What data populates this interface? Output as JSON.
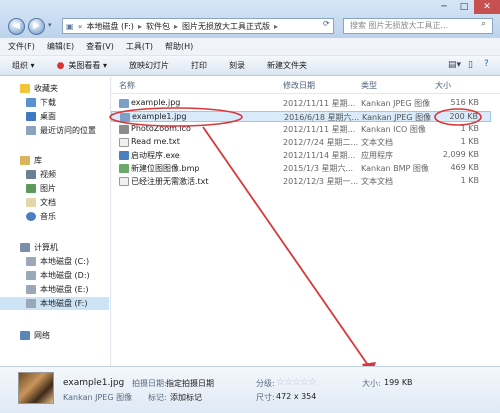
{
  "window": {
    "breadcrumb": [
      "本地磁盘 (F:)",
      "软件包",
      "图片无损放大工具正式版"
    ],
    "search_placeholder": "搜索 图片无损放大工具正...",
    "controls": [
      "─",
      "□",
      "✕"
    ]
  },
  "menu": [
    "文件(F)",
    "编辑(E)",
    "查看(V)",
    "工具(T)",
    "帮助(H)"
  ],
  "toolbar": [
    "组织 ▾",
    "美图看看 ▾",
    "放映幻灯片",
    "打印",
    "刻录",
    "新建文件夹"
  ],
  "nav": {
    "favorites": {
      "label": "收藏夹",
      "items": [
        "下载",
        "桌面",
        "最近访问的位置"
      ]
    },
    "libraries": {
      "label": "库",
      "items": [
        "视频",
        "图片",
        "文档",
        "音乐"
      ]
    },
    "computer": {
      "label": "计算机",
      "items": [
        "本地磁盘 (C:)",
        "本地磁盘 (D:)",
        "本地磁盘 (E:)",
        "本地磁盘 (F:)"
      ]
    },
    "network": "网络"
  },
  "columns": {
    "name": "名称",
    "date": "修改日期",
    "type": "类型",
    "size": "大小"
  },
  "files": [
    {
      "name": "example.jpg",
      "date": "2012/11/11 星期...",
      "type": "Kankan JPEG 图像",
      "size": "516 KB",
      "color": "#7aa0c8"
    },
    {
      "name": "example1.jpg",
      "date": "2016/6/18 星期六...",
      "type": "Kankan JPEG 图像",
      "size": "200 KB",
      "color": "#7aa0c8"
    },
    {
      "name": "PhotoZoom.ico",
      "date": "2012/11/11 星期...",
      "type": "Kankan ICO 图像",
      "size": "1 KB",
      "color": "#8c8c8c"
    },
    {
      "name": "Read me.txt",
      "date": "2012/7/24 星期二...",
      "type": "文本文档",
      "size": "1 KB",
      "color": "#e8e8e8"
    },
    {
      "name": "启动程序.exe",
      "date": "2012/11/14 星期...",
      "type": "应用程序",
      "size": "2,099 KB",
      "color": "#4a7fc0"
    },
    {
      "name": "新建位图图像.bmp",
      "date": "2015/1/3 星期六...",
      "type": "Kankan BMP 图像",
      "size": "469 KB",
      "color": "#6ba86b"
    },
    {
      "name": "已经注册无需激活.txt",
      "date": "2012/12/3 星期一...",
      "type": "文本文档",
      "size": "1 KB",
      "color": "#e8e8e8"
    }
  ],
  "details": {
    "filename": "example1.jpg",
    "filetype": "Kankan JPEG 图像",
    "taken_label": "拍摄日期:",
    "taken_value": "指定拍摄日期",
    "tags_label": "标记:",
    "tags_value": "添加标记",
    "rating_label": "分级:",
    "rating_stars": "☆☆☆☆☆",
    "dims_label": "尺寸:",
    "dims_value": "472 x 354",
    "size_label": "大小:",
    "size_value": "199 KB"
  }
}
